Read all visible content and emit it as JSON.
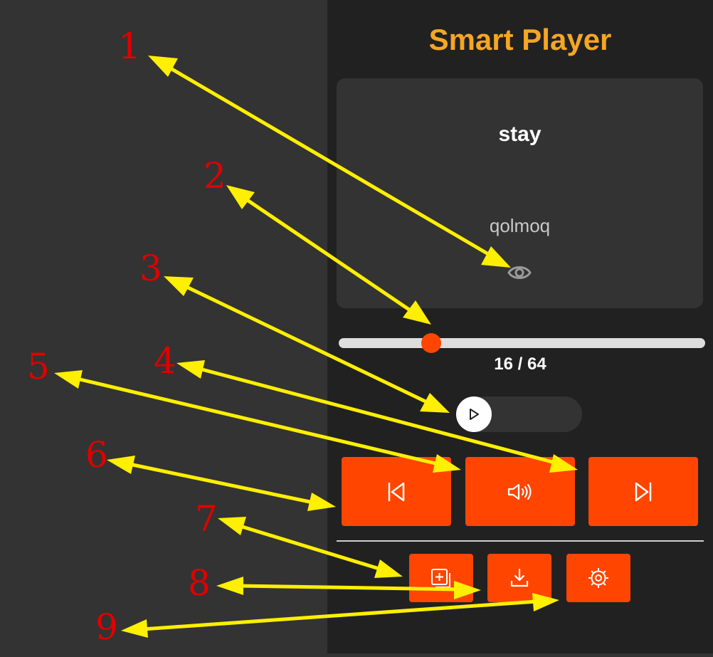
{
  "app": {
    "title": "Smart Player"
  },
  "card": {
    "word": "stay",
    "transliteration": "qolmoq"
  },
  "progress": {
    "current": 16,
    "total": 64,
    "label": "16 / 64"
  },
  "player": {
    "autoplay_on": false
  },
  "controls": [
    {
      "name": "previous",
      "icon": "skip-back-icon"
    },
    {
      "name": "speak",
      "icon": "speaker-icon"
    },
    {
      "name": "next",
      "icon": "skip-forward-icon"
    }
  ],
  "actions": [
    {
      "name": "add-card",
      "icon": "add-card-icon"
    },
    {
      "name": "download",
      "icon": "download-icon"
    },
    {
      "name": "settings",
      "icon": "gear-icon"
    }
  ],
  "annotations": {
    "n1": "1",
    "n2": "2",
    "n3": "3",
    "n4": "4",
    "n5": "5",
    "n6": "6",
    "n7": "7",
    "n8": "8",
    "n9": "9"
  },
  "colors": {
    "accent": "#ff4500",
    "title": "#f5a623",
    "panel": "#212121",
    "background": "#333333",
    "annotation_number": "#e10000",
    "annotation_arrow": "#ffef00"
  }
}
